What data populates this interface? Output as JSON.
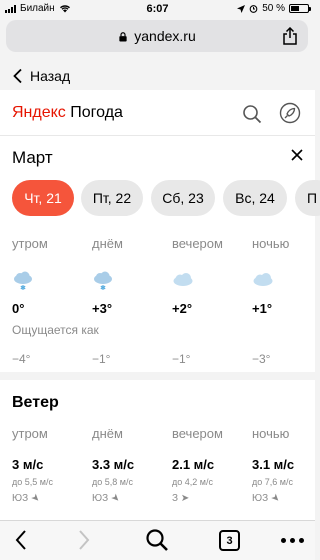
{
  "status_bar": {
    "carrier": "Билайн",
    "time": "6:07",
    "battery": "50 %",
    "battery_level": 0.5
  },
  "browser": {
    "url": "yandex.ru",
    "back_label": "Назад",
    "tabs_count": "3"
  },
  "header": {
    "logo_brand": "Яндекс",
    "logo_service": "Погода"
  },
  "calendar": {
    "month": "Март",
    "days": [
      {
        "label": "Чт, 21",
        "active": true
      },
      {
        "label": "Пт, 22",
        "active": false
      },
      {
        "label": "Сб, 23",
        "active": false
      },
      {
        "label": "Вс, 24",
        "active": false
      },
      {
        "label": "П",
        "active": false
      }
    ]
  },
  "forecast": {
    "periods": [
      {
        "name": "утром",
        "temp": "0°",
        "feels": "−4°"
      },
      {
        "name": "днём",
        "temp": "+3°",
        "feels": "−1°"
      },
      {
        "name": "вечером",
        "temp": "+2°",
        "feels": "−1°"
      },
      {
        "name": "ночью",
        "temp": "+1°",
        "feels": "−3°"
      }
    ],
    "feels_label": "Ощущается как"
  },
  "wind": {
    "title": "Ветер",
    "periods": [
      {
        "name": "утром",
        "speed": "3 м/с",
        "gust": "до 5,5 м/с",
        "dir": "ЮЗ"
      },
      {
        "name": "днём",
        "speed": "3.3 м/с",
        "gust": "до 5,8 м/с",
        "dir": "ЮЗ"
      },
      {
        "name": "вечером",
        "speed": "2.1 м/с",
        "gust": "до 4,2 м/с",
        "dir": "З"
      },
      {
        "name": "ночью",
        "speed": "3.1 м/с",
        "gust": "до 7,6 м/с",
        "dir": "ЮЗ"
      }
    ]
  }
}
